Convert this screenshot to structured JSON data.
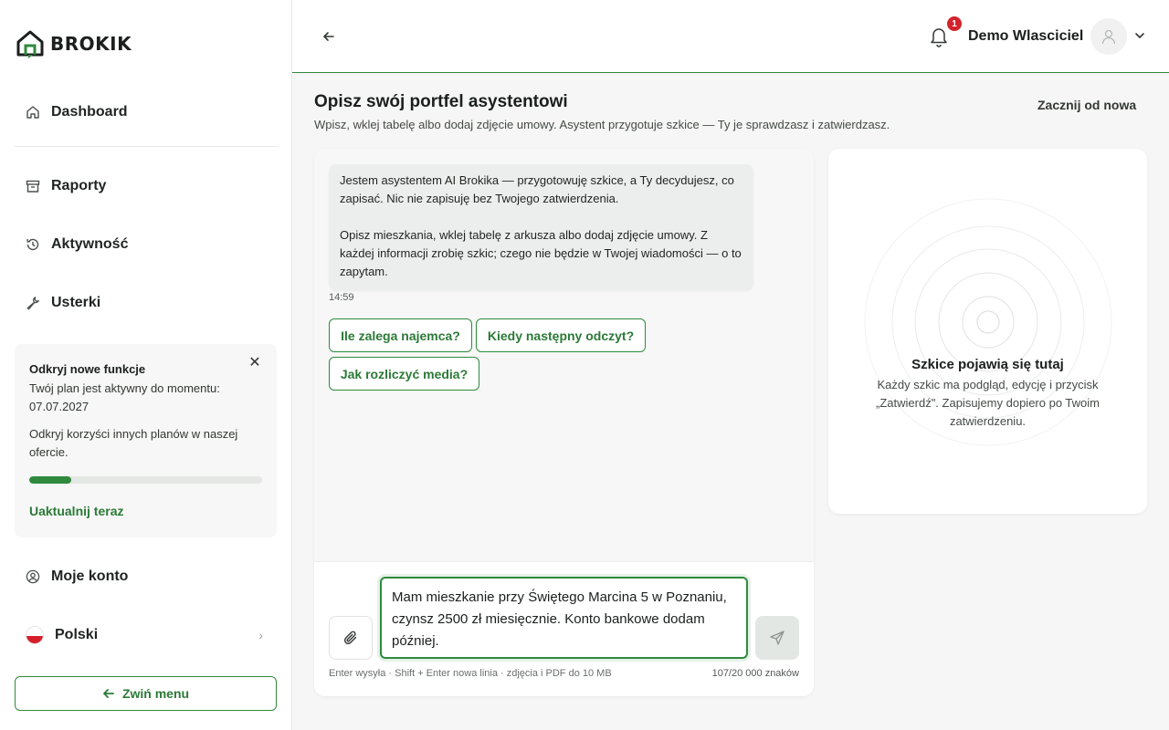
{
  "brand": {
    "name": "BROKIK"
  },
  "colors": {
    "accent": "#2f8a3e",
    "badge": "#d3232c"
  },
  "sidebar": {
    "items": [
      {
        "label": "Dashboard",
        "icon": "home-icon"
      },
      {
        "label": "Raporty",
        "icon": "archive-icon"
      },
      {
        "label": "Aktywność",
        "icon": "history-icon"
      },
      {
        "label": "Usterki",
        "icon": "wrench-icon"
      }
    ],
    "promo": {
      "title": "Odkryj nowe funkcje",
      "text": "Twój plan jest aktywny do momentu: 07.07.2027",
      "text2": "Odkryj korzyści innych planów w naszej ofercie.",
      "progress": 0.18,
      "link": "Uaktualnij teraz"
    },
    "account": {
      "label": "Moje konto",
      "icon": "user-circle-icon"
    },
    "language": {
      "label": "Polski"
    },
    "collapse": {
      "label": "Zwiń menu"
    }
  },
  "header": {
    "notifications": "1",
    "user_name": "Demo Wlasciciel"
  },
  "main": {
    "title": "Opisz swój portfel asystentowi",
    "subtitle": "Wpisz, wklej tabelę albo dodaj zdjęcie umowy. Asystent przygotuje szkice — Ty je sprawdzasz i zatwierdzasz.",
    "restart": "Zacznij od nowa"
  },
  "chat": {
    "message_p1": "Jestem asystentem AI Brokika — przygotowuję szkice, a Ty decydujesz, co zapisać. Nic nie zapisuję bez Twojego zatwierdzenia.",
    "message_p2": "Opisz mieszkania, wklej tabelę z arkusza albo dodaj zdjęcie umowy. Z każdej informacji zrobię szkic; czego nie będzie w Twojej wiadomości — o to zapytam.",
    "time": "14:59",
    "suggestions": [
      "Ile zalega najemca?",
      "Kiedy następny odczyt?",
      "Jak rozliczyć media?"
    ],
    "input_value": "Mam mieszkanie przy Świętego Marcina 5 w Poznaniu, czynsz 2500 zł miesięcznie. Konto bankowe dodam później.",
    "hint": "Enter wysyła · Shift + Enter nowa linia · zdjęcia i PDF do 10 MB",
    "counter": "107/20 000 znaków"
  },
  "drafts": {
    "title": "Szkice pojawią się tutaj",
    "text": "Każdy szkic ma podgląd, edycję i przycisk „Zatwierdź\". Zapisujemy dopiero po Twoim zatwierdzeniu."
  }
}
